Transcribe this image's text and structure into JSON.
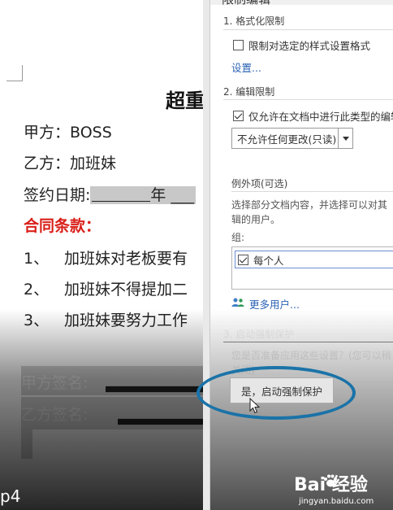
{
  "document": {
    "title_partial": "超重",
    "party_a": "甲方：BOSS",
    "party_b": "乙方：加班妹",
    "sign_date_label": "签约日期:",
    "sign_date_year": "年",
    "clauses_heading": "合同条款：",
    "clauses": [
      {
        "num": "1、",
        "text": "加班妹对老板要有"
      },
      {
        "num": "2、",
        "text": "加班妹不得提加二"
      },
      {
        "num": "3、",
        "text": "加班妹要努力工作"
      }
    ],
    "sign_a_label": "甲方签名:",
    "sign_b_label": "乙方签名:"
  },
  "pane": {
    "header_partial": "限制编辑",
    "section1_title": "1. 格式化限制",
    "section1_checkbox": "限制对选定的样式设置格式",
    "section1_link": "设置...",
    "section2_title": "2. 编辑限制",
    "section2_checkbox": "仅允许在文档中进行此类型的编辑",
    "edit_type_value": "不允许任何更改(只读)",
    "exceptions_title": "例外项(可选)",
    "exceptions_desc_line1": "选择部分文档内容，并选择可以对其",
    "exceptions_desc_line2": "辑的用户。",
    "group_label": "组:",
    "group_item": "每个人",
    "more_users": "更多用户...",
    "section3_title": "3. 启动强制保护",
    "section3_desc_line1": "您是否准备应用这些设置？(您可以稍",
    "section3_desc_line2": "关闭)",
    "confirm_button": "是，启动强制保护"
  },
  "overlay": {
    "page_label": "p4",
    "watermark_brand": "Bai  经验",
    "watermark_url": "jingyan.baidu.com"
  },
  "colors": {
    "accent_link": "#2b63b5",
    "clause_heading": "#d9201a",
    "highlight_oval": "#1a73a8"
  }
}
